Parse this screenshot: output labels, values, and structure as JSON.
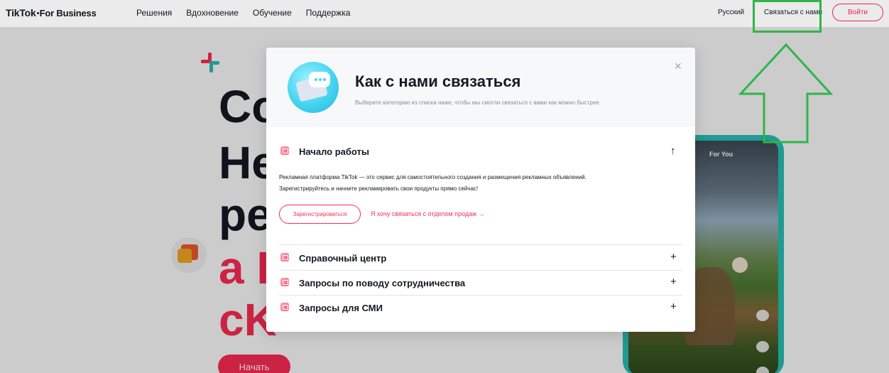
{
  "header": {
    "logo": {
      "brand": "TikTok",
      "sub": "For Business"
    },
    "nav": [
      "Решения",
      "Вдохновение",
      "Обучение",
      "Поддержка"
    ],
    "language": "Русский",
    "contact_link": "Связаться с нами",
    "login_button": "Войти"
  },
  "hero": {
    "lines": [
      "Co",
      "He",
      "pe",
      "a I",
      "cK"
    ],
    "start_button": "Начать",
    "phone_tab": "For You"
  },
  "modal": {
    "title": "Как с нами связаться",
    "subtitle": "Выберите категорию из списка ниже, чтобы мы смогли связаться с вами как можно быстрее.",
    "sections": [
      {
        "title": "Начало работы",
        "expanded": true,
        "toggle": "↑",
        "description_line1": "Рекламная платформа TikTok — это сервис для самостоятельного создания и размещения рекламных объявлений.",
        "description_line2": "Зарегистрируйтесь и начните рекламировать свои продукты прямо сейчас!",
        "register_button": "Зарегистрироваться",
        "sales_link": "Я хочу связаться с отделом продаж →"
      },
      {
        "title": "Справочный центр",
        "expanded": false,
        "toggle": "+"
      },
      {
        "title": "Запросы по поводу сотрудничества",
        "expanded": false,
        "toggle": "+"
      },
      {
        "title": "Запросы для СМИ",
        "expanded": false,
        "toggle": "+"
      }
    ]
  },
  "colors": {
    "brand_red": "#fe2c55",
    "highlight_green": "#2fb54a",
    "phone_frame": "#27c2b7"
  }
}
